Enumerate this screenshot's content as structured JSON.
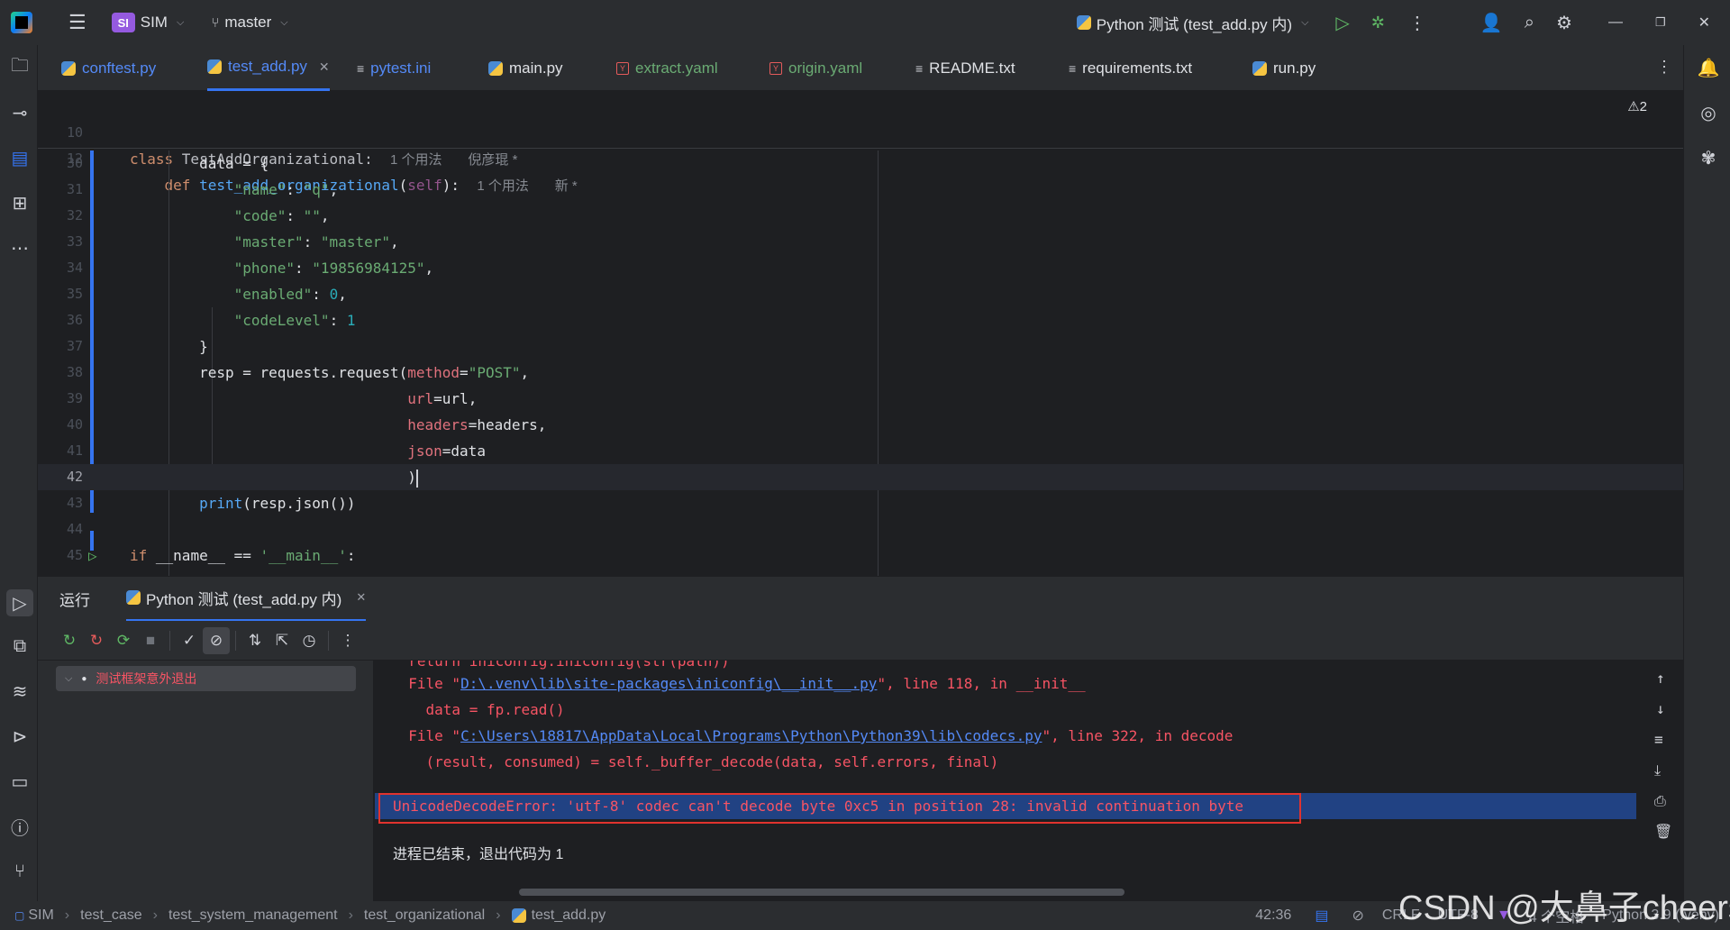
{
  "titlebar": {
    "project_badge": "SI",
    "project_name": "SIM",
    "branch": "master",
    "run_config": "Python 测试 (test_add.py 内)"
  },
  "tabs": [
    {
      "label": "conftest.py",
      "type": "py",
      "color": "#548af7"
    },
    {
      "label": "test_add.py",
      "type": "py",
      "color": "#548af7"
    },
    {
      "label": "pytest.ini",
      "type": "ini",
      "color": "#548af7"
    },
    {
      "label": "main.py",
      "type": "py",
      "color": "#dfe1e5"
    },
    {
      "label": "extract.yaml",
      "type": "yaml",
      "color": "#6aab73"
    },
    {
      "label": "origin.yaml",
      "type": "yaml",
      "color": "#6aab73"
    },
    {
      "label": "README.txt",
      "type": "txt",
      "color": "#dfe1e5"
    },
    {
      "label": "requirements.txt",
      "type": "txt",
      "color": "#dfe1e5"
    },
    {
      "label": "run.py",
      "type": "py",
      "color": "#dfe1e5"
    }
  ],
  "editor": {
    "warnings": "⚠2",
    "sticky": [
      {
        "num": "10",
        "hint_usages": "1 个用法",
        "hint_author": "倪彦琨 *"
      },
      {
        "num": "12",
        "hint_usages": "1 个用法",
        "hint_new": "新 *"
      }
    ],
    "line_numbers": [
      "30",
      "31",
      "32",
      "33",
      "34",
      "35",
      "36",
      "37",
      "38",
      "39",
      "40",
      "41",
      "42",
      "43",
      "44",
      "45"
    ],
    "strings": {
      "name_key": "\"name\"",
      "name_val": "\"q\"",
      "code_key": "\"code\"",
      "code_val": "\"\"",
      "master_key": "\"master\"",
      "master_val": "\"master\"",
      "phone_key": "\"phone\"",
      "phone_val": "\"19856984125\"",
      "enabled_key": "\"enabled\"",
      "enabled_val": "0",
      "level_key": "\"codeLevel\"",
      "level_val": "1",
      "method_val": "\"POST\"",
      "main_val": "'__main__'"
    }
  },
  "run_panel": {
    "title": "运行",
    "tab_label": "Python 测试 (test_add.py 内)",
    "tree_item": "测试框架意外退出",
    "console": {
      "line0": "  return iniconfig.iniconfig(str(path))",
      "file1_prefix": "  File \"",
      "file1_path": "D:\\.venv\\lib\\site-packages\\iniconfig\\__init__.py",
      "file1_suffix": "\", line 118, in __init__",
      "line2": "    data = fp.read()",
      "file2_prefix": "  File \"",
      "file2_path": "C:\\Users\\18817\\AppData\\Local\\Programs\\Python\\Python39\\lib\\codecs.py",
      "file2_suffix": "\", line 322, in decode",
      "line4": "    (result, consumed) = self._buffer_decode(data, self.errors, final)",
      "error": "UnicodeDecodeError: 'utf-8' codec can't decode byte 0xc5 in position 28: invalid continuation byte",
      "exit": "进程已结束，退出代码为 1"
    }
  },
  "statusbar": {
    "breadcrumbs": [
      "SIM",
      "test_case",
      "test_system_management",
      "test_organizational",
      "test_add.py"
    ],
    "position": "42:36",
    "line_ending": "CRLF",
    "encoding": "UTF-8",
    "indent": "4 个空格",
    "interpreter": "Python 3.9 (.venv)"
  },
  "watermark": "CSDN @大鼻子cheers"
}
